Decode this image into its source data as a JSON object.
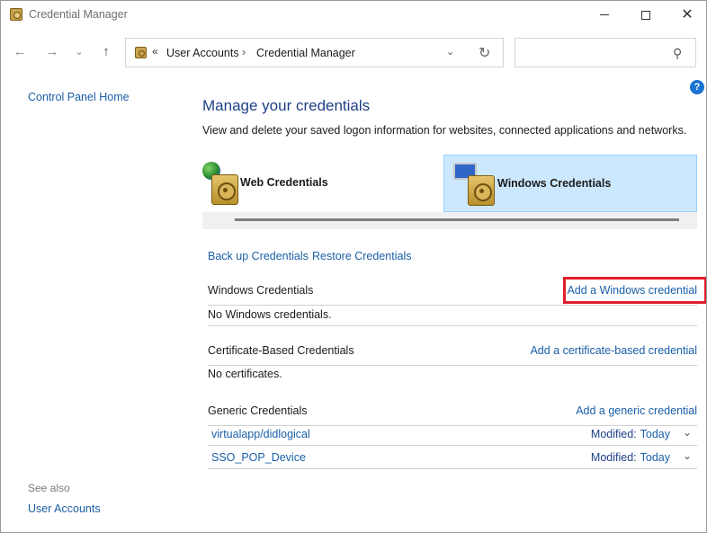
{
  "window": {
    "title": "Credential Manager"
  },
  "address": {
    "prefix": "«",
    "crumbs": [
      "User Accounts",
      "Credential Manager"
    ],
    "separator": "›"
  },
  "search": {
    "placeholder": ""
  },
  "left_pane": {
    "home_link": "Control Panel Home",
    "see_also_label": "See also",
    "see_also_links": [
      "User Accounts"
    ]
  },
  "help": {
    "label": "?"
  },
  "main": {
    "title": "Manage your credentials",
    "description": "View and delete your saved logon information for websites, connected applications and networks.",
    "tabs": [
      {
        "label": "Web Credentials",
        "selected": false
      },
      {
        "label": "Windows Credentials",
        "selected": true
      }
    ],
    "actions": {
      "backup": "Back up Credentials",
      "restore": "Restore Credentials"
    },
    "sections": {
      "windows": {
        "title": "Windows Credentials",
        "add_link": "Add a Windows credential",
        "empty_text": "No Windows credentials."
      },
      "certificate": {
        "title": "Certificate-Based Credentials",
        "add_link": "Add a certificate-based credential",
        "empty_text": "No certificates."
      },
      "generic": {
        "title": "Generic Credentials",
        "add_link": "Add a generic credential",
        "items": [
          {
            "name": "virtualapp/didlogical",
            "modified_label": "Modified:",
            "modified_value": "Today"
          },
          {
            "name": "SSO_POP_Device",
            "modified_label": "Modified:",
            "modified_value": "Today"
          }
        ]
      }
    }
  },
  "colors": {
    "link": "#1a5fa8",
    "heading": "#1e3f87",
    "selected_tab": "#cce8ff",
    "highlight_box": "#e11d2a"
  }
}
